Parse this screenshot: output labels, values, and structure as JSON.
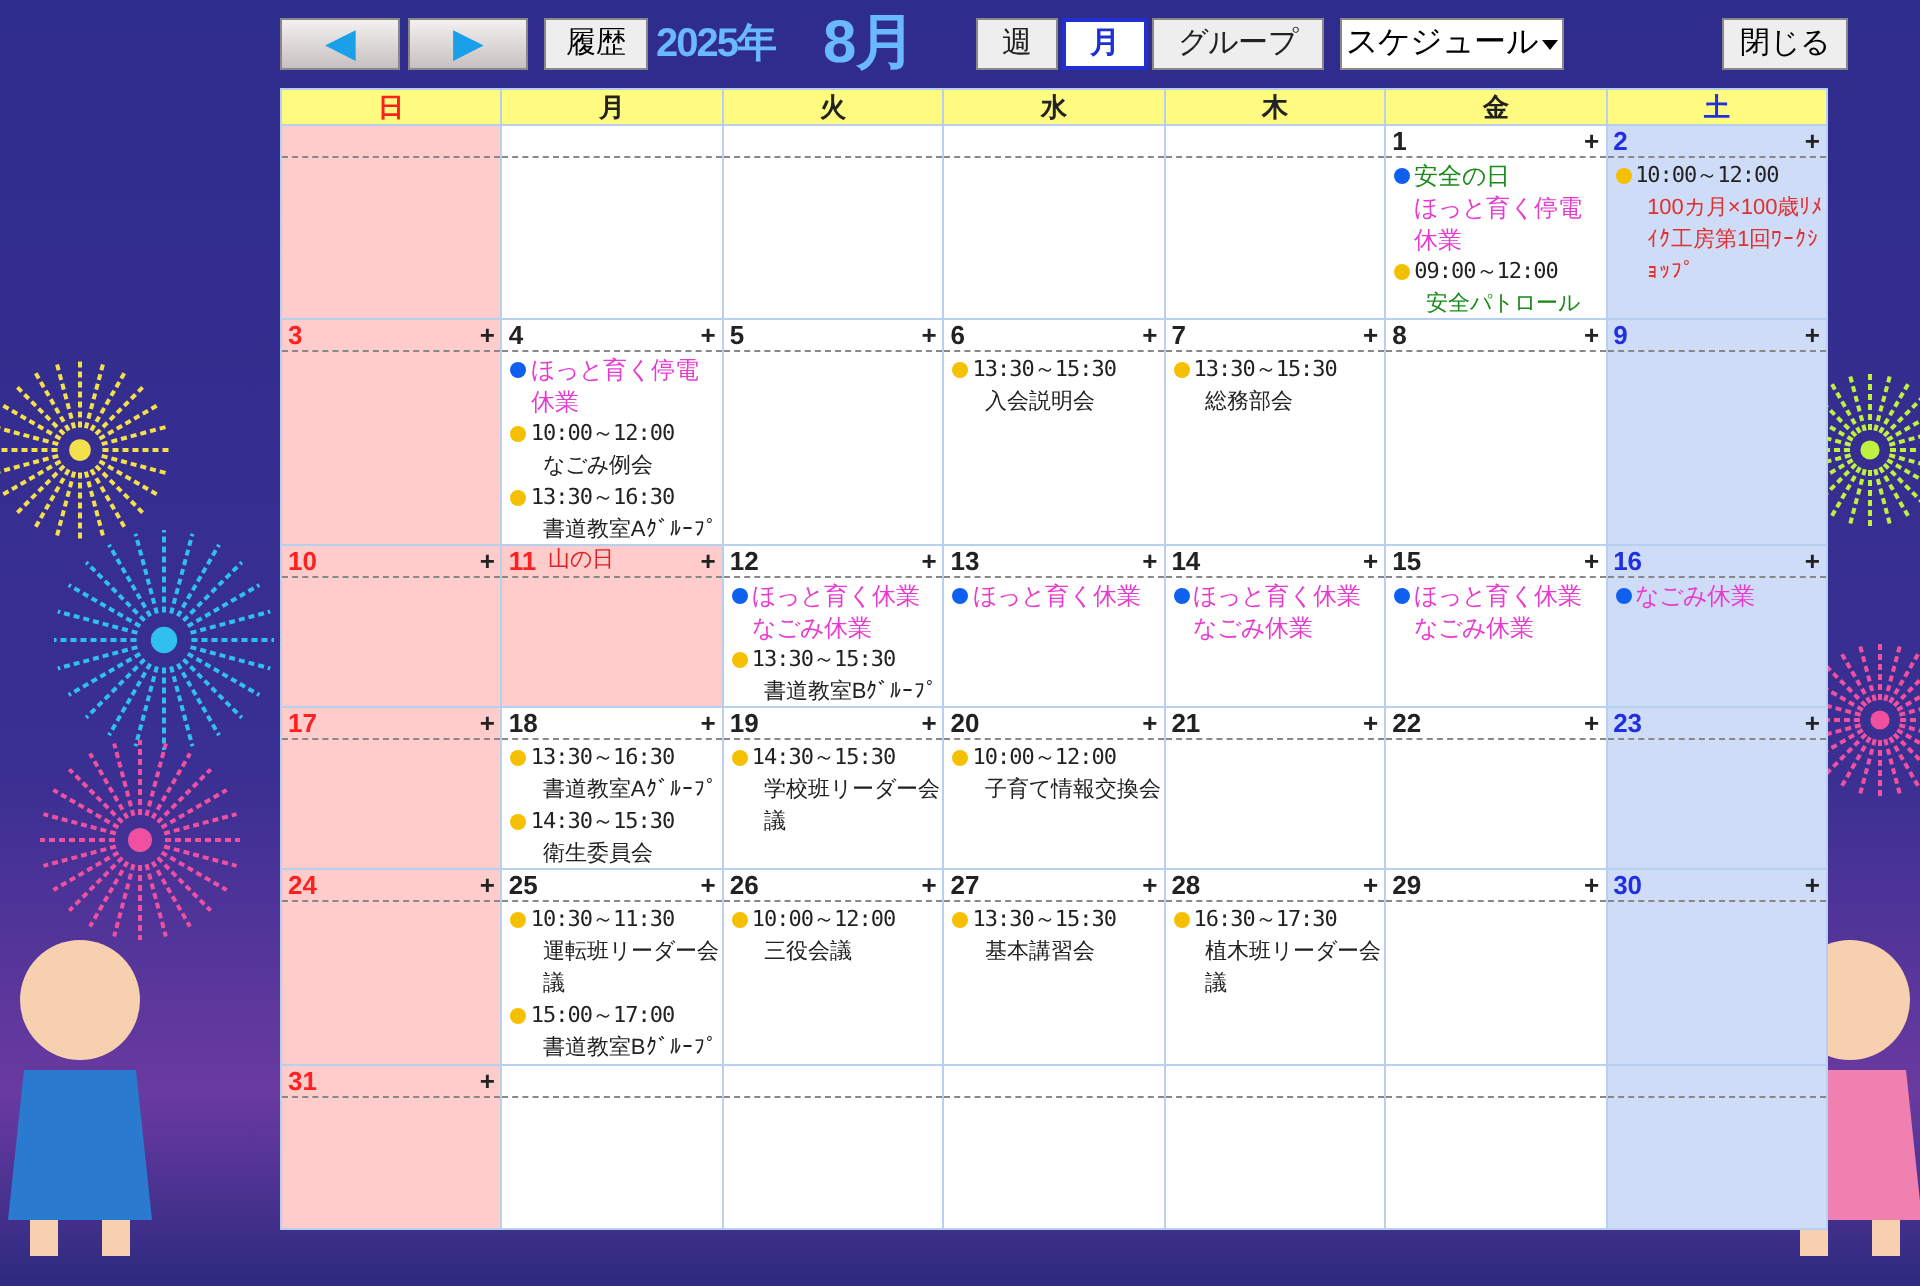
{
  "toolbar": {
    "prev": "◀",
    "next": "▶",
    "history": "履歴",
    "year": "2025年",
    "month": "8月",
    "views": [
      {
        "label": "週",
        "selected": false
      },
      {
        "label": "月",
        "selected": true
      },
      {
        "label": "グループ",
        "selected": false
      }
    ],
    "select": "スケジュール",
    "close": "閉じる"
  },
  "weekdays": [
    "日",
    "月",
    "火",
    "水",
    "木",
    "金",
    "土"
  ],
  "weeks": [
    [
      {
        "kind": "blank"
      },
      {
        "kind": "blank"
      },
      {
        "kind": "blank"
      },
      {
        "kind": "blank"
      },
      {
        "kind": "blank"
      },
      {
        "day": "1",
        "events": [
          {
            "kind": "allday",
            "items": [
              {
                "title": "安全の日",
                "color": "#1a8a1a"
              },
              {
                "title": "ほっと育く停電休業",
                "color": "#e83ad0"
              }
            ]
          },
          {
            "kind": "timed",
            "time": "09:00～12:00",
            "title": "安全パトロール",
            "color": "#1a8a1a"
          }
        ]
      },
      {
        "day": "2",
        "events": [
          {
            "kind": "timed",
            "time": "10:00～12:00",
            "title": "100カ月×100歳ﾘﾒｲｸ工房第1回ﾜｰｸｼｮｯﾌﾟ",
            "color": "#e03030"
          }
        ]
      }
    ],
    [
      {
        "day": "3"
      },
      {
        "day": "4",
        "events": [
          {
            "kind": "allday",
            "items": [
              {
                "title": "ほっと育く停電休業",
                "color": "#e83ad0"
              }
            ]
          },
          {
            "kind": "timed",
            "time": "10:00～12:00",
            "title": "なごみ例会",
            "color": "#222222"
          },
          {
            "kind": "timed",
            "time": "13:30～16:30",
            "title": "書道教室Aｸﾞﾙｰﾌﾟ",
            "color": "#222222"
          }
        ]
      },
      {
        "day": "5"
      },
      {
        "day": "6",
        "events": [
          {
            "kind": "timed",
            "time": "13:30～15:30",
            "title": "入会説明会",
            "color": "#222222"
          }
        ]
      },
      {
        "day": "7",
        "events": [
          {
            "kind": "timed",
            "time": "13:30～15:30",
            "title": "総務部会",
            "color": "#222222"
          }
        ]
      },
      {
        "day": "8"
      },
      {
        "day": "9"
      }
    ],
    [
      {
        "day": "10"
      },
      {
        "day": "11",
        "holiday": "山の日"
      },
      {
        "day": "12",
        "events": [
          {
            "kind": "allday",
            "items": [
              {
                "title": "ほっと育く休業",
                "color": "#e83ad0"
              },
              {
                "title": "なごみ休業",
                "color": "#e83ad0"
              }
            ]
          },
          {
            "kind": "timed",
            "time": "13:30～15:30",
            "title": "書道教室Bｸﾞﾙｰﾌﾟ",
            "color": "#222222"
          }
        ]
      },
      {
        "day": "13",
        "events": [
          {
            "kind": "allday",
            "items": [
              {
                "title": "ほっと育く休業",
                "color": "#e83ad0"
              }
            ]
          }
        ]
      },
      {
        "day": "14",
        "events": [
          {
            "kind": "allday",
            "items": [
              {
                "title": "ほっと育く休業",
                "color": "#e83ad0"
              },
              {
                "title": "なごみ休業",
                "color": "#e83ad0"
              }
            ]
          }
        ]
      },
      {
        "day": "15",
        "events": [
          {
            "kind": "allday",
            "items": [
              {
                "title": "ほっと育く休業",
                "color": "#e83ad0"
              },
              {
                "title": "なごみ休業",
                "color": "#e83ad0"
              }
            ]
          }
        ]
      },
      {
        "day": "16",
        "events": [
          {
            "kind": "allday",
            "items": [
              {
                "title": "なごみ休業",
                "color": "#e83ad0"
              }
            ]
          }
        ]
      }
    ],
    [
      {
        "day": "17"
      },
      {
        "day": "18",
        "events": [
          {
            "kind": "timed",
            "time": "13:30～16:30",
            "title": "書道教室Aｸﾞﾙｰﾌﾟ",
            "color": "#222222"
          },
          {
            "kind": "timed",
            "time": "14:30～15:30",
            "title": "衛生委員会",
            "color": "#222222"
          }
        ]
      },
      {
        "day": "19",
        "events": [
          {
            "kind": "timed",
            "time": "14:30～15:30",
            "title": "学校班リーダー会議",
            "color": "#222222"
          }
        ]
      },
      {
        "day": "20",
        "events": [
          {
            "kind": "timed",
            "time": "10:00～12:00",
            "title": "子育て情報交換会",
            "color": "#222222"
          }
        ]
      },
      {
        "day": "21"
      },
      {
        "day": "22"
      },
      {
        "day": "23"
      }
    ],
    [
      {
        "day": "24"
      },
      {
        "day": "25",
        "events": [
          {
            "kind": "timed",
            "time": "10:30～11:30",
            "title": "運転班リーダー会議",
            "color": "#222222"
          },
          {
            "kind": "timed",
            "time": "15:00～17:00",
            "title": "書道教室Bｸﾞﾙｰﾌﾟ",
            "color": "#222222"
          }
        ]
      },
      {
        "day": "26",
        "events": [
          {
            "kind": "timed",
            "time": "10:00～12:00",
            "title": "三役会議",
            "color": "#222222"
          }
        ]
      },
      {
        "day": "27",
        "events": [
          {
            "kind": "timed",
            "time": "13:30～15:30",
            "title": "基本講習会",
            "color": "#222222"
          }
        ]
      },
      {
        "day": "28",
        "events": [
          {
            "kind": "timed",
            "time": "16:30～17:30",
            "title": "植木班リーダー会議",
            "color": "#222222"
          }
        ]
      },
      {
        "day": "29"
      },
      {
        "day": "30"
      }
    ],
    [
      {
        "day": "31"
      },
      {
        "kind": "blank"
      },
      {
        "kind": "blank"
      },
      {
        "kind": "blank"
      },
      {
        "kind": "blank"
      },
      {
        "kind": "blank"
      },
      {
        "kind": "blank"
      }
    ]
  ],
  "add_mark": "+"
}
